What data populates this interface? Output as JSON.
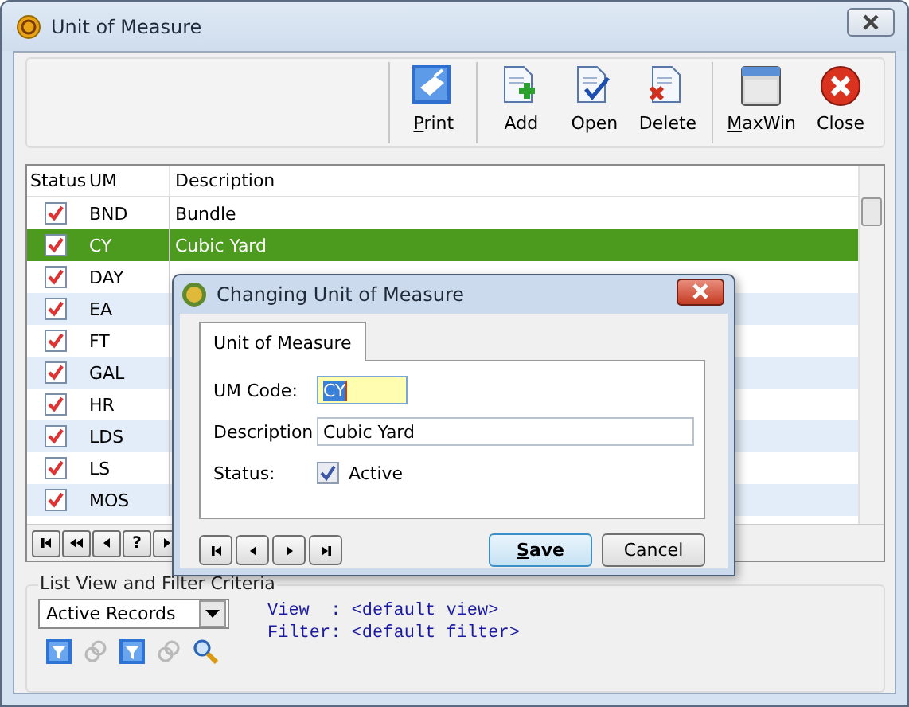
{
  "window": {
    "title": "Unit of Measure"
  },
  "toolbar": {
    "groups": [
      [
        {
          "label": "Print",
          "kind": "print",
          "mnemonic": true
        }
      ],
      [
        {
          "label": "Add",
          "kind": "add",
          "mnemonic": false
        },
        {
          "label": "Open",
          "kind": "open",
          "mnemonic": false
        },
        {
          "label": "Delete",
          "kind": "delete",
          "mnemonic": false
        }
      ],
      [
        {
          "label": "MaxWin",
          "kind": "maxwin",
          "mnemonic": true
        },
        {
          "label": "Close",
          "kind": "close",
          "mnemonic": false
        }
      ]
    ]
  },
  "grid": {
    "columns": [
      "Status",
      "UM",
      "Description"
    ],
    "rows": [
      {
        "checked": true,
        "um": "BND",
        "description": "Bundle",
        "selected": false
      },
      {
        "checked": true,
        "um": "CY",
        "description": "Cubic Yard",
        "selected": true
      },
      {
        "checked": true,
        "um": "DAY",
        "selected": false
      },
      {
        "checked": true,
        "um": "EA",
        "selected": false
      },
      {
        "checked": true,
        "um": "FT",
        "selected": false
      },
      {
        "checked": true,
        "um": "GAL",
        "selected": false
      },
      {
        "checked": true,
        "um": "HR",
        "selected": false
      },
      {
        "checked": true,
        "um": "LDS",
        "selected": false
      },
      {
        "checked": true,
        "um": "LS",
        "selected": false
      },
      {
        "checked": true,
        "um": "MOS",
        "selected": false
      }
    ],
    "nav": [
      {
        "kind": "first"
      },
      {
        "kind": "prev-page"
      },
      {
        "kind": "prev"
      },
      {
        "kind": "help",
        "label": "?"
      },
      {
        "kind": "next"
      }
    ]
  },
  "filter": {
    "legend": "List View and Filter Criteria",
    "dropdown": "Active Records",
    "icons": [
      {
        "kind": "filter",
        "disabled": false
      },
      {
        "kind": "link",
        "disabled": true
      },
      {
        "kind": "filter",
        "disabled": false
      },
      {
        "kind": "link",
        "disabled": true
      },
      {
        "kind": "search",
        "disabled": false
      }
    ],
    "view_line": "View  : <default view>",
    "filter_line": "Filter: <default filter>"
  },
  "dialog": {
    "title": "Changing Unit of Measure",
    "tabs": [
      {
        "label": "Unit of Measure",
        "selected": true
      }
    ],
    "um_code": {
      "label": "UM Code:",
      "value": "CY"
    },
    "description": {
      "label": "Description",
      "value": "Cubic Yard"
    },
    "status": {
      "label": "Status:",
      "option": "Active",
      "checked": true
    },
    "nav": [
      {
        "kind": "first"
      },
      {
        "kind": "prev"
      },
      {
        "kind": "next"
      },
      {
        "kind": "last"
      }
    ],
    "buttons": [
      {
        "label": "Save",
        "default": true,
        "mnemonic": true
      },
      {
        "label": "Cancel",
        "default": false,
        "mnemonic": false
      }
    ]
  }
}
